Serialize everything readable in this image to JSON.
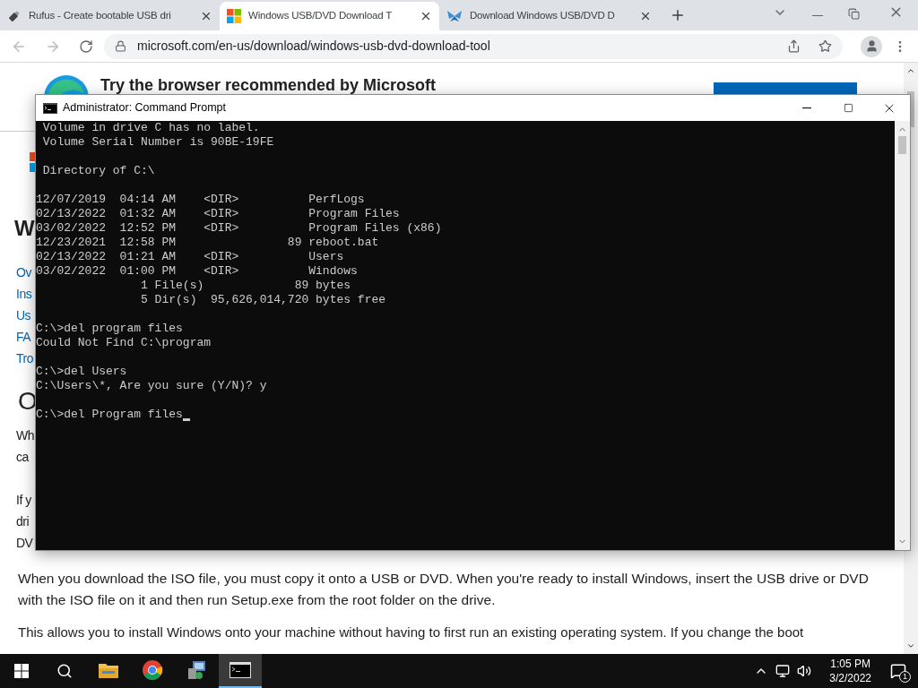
{
  "browser": {
    "tabs": [
      {
        "title": "Rufus - Create bootable USB dri",
        "selected": false
      },
      {
        "title": "Windows USB/DVD Download T",
        "selected": true
      },
      {
        "title": "Download Windows USB/DVD D",
        "selected": false
      }
    ],
    "address": "microsoft.com/en-us/download/windows-usb-dvd-download-tool"
  },
  "page": {
    "banner": {
      "title": "Try the browser recommended by Microsoft"
    },
    "heading": "W",
    "nav_links": [
      "Ov",
      "Ins",
      "Us",
      "FA",
      "Tro"
    ],
    "section_heading": "O",
    "fragments": [
      [
        "Wh",
        "ca"
      ],
      [
        "If y",
        "dri",
        "DV"
      ]
    ],
    "paragraphs": [
      "When you download the ISO file, you must copy it onto a USB or DVD. When you're ready to install Windows, insert the USB drive or DVD with the ISO file on it and then run Setup.exe from the root folder on the drive.",
      "This allows you to install Windows onto your machine without having to first run an existing operating system. If you change the boot"
    ]
  },
  "console": {
    "title": "Administrator: Command Prompt",
    "blocks": [
      [
        " Volume in drive C has no label.",
        " Volume Serial Number is 90BE-19FE"
      ],
      [
        " Directory of C:\\"
      ],
      [
        "12/07/2019  04:14 AM    <DIR>          PerfLogs",
        "02/13/2022  01:32 AM    <DIR>          Program Files",
        "03/02/2022  12:52 PM    <DIR>          Program Files (x86)",
        "12/23/2021  12:58 PM                89 reboot.bat",
        "02/13/2022  01:21 AM    <DIR>          Users",
        "03/02/2022  01:00 PM    <DIR>          Windows",
        "               1 File(s)             89 bytes",
        "               5 Dir(s)  95,626,014,720 bytes free"
      ],
      [
        "C:\\>del program files",
        "Could Not Find C:\\program"
      ],
      [
        "C:\\>del Users",
        "C:\\Users\\*, Are you sure (Y/N)? y"
      ],
      [
        "C:\\>del Program files"
      ]
    ]
  },
  "taskbar": {
    "apps": [
      {
        "selected": false
      },
      {
        "selected": false
      },
      {
        "selected": false
      },
      {
        "selected": true
      }
    ],
    "clock": {
      "time": "1:05 PM",
      "date": "3/2/2022"
    },
    "notifications": "1"
  }
}
